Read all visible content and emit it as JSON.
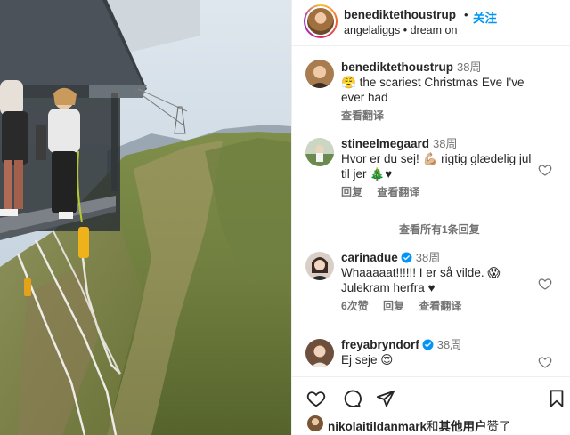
{
  "post": {
    "username": "benediktethoustrup",
    "follow_label": "关注",
    "separator": "•",
    "collaborator": "angelaliggs",
    "audio": "dream on"
  },
  "comments": [
    {
      "username": "benediktethoustrup",
      "time": "38周",
      "emoji": "😤",
      "text": "the scariest Christmas Eve I've ever had",
      "translate_label": "查看翻译"
    },
    {
      "username": "stineelmegaard",
      "time": "38周",
      "text": "Hvor er du sej! 💪🏼 rigtig glædelig jul til jer 🎄♥",
      "reply_label": "回复",
      "translate_label": "查看翻译",
      "view_replies_label": "查看所有1条回复"
    },
    {
      "username": "carinadue",
      "verified": true,
      "time": "38周",
      "text": "Whaaaaat!!!!!! I er så vilde. 😱 Julekram herfra ♥",
      "likes_label": "6次赞",
      "reply_label": "回复",
      "translate_label": "查看翻译"
    },
    {
      "username": "freyabryndorf",
      "verified": true,
      "time": "38周",
      "text": "Ej seje 😍"
    }
  ],
  "likes": {
    "user": "nikolaitildanmark",
    "joiner": "和",
    "others": "其他用户",
    "suffix": "赞了"
  },
  "icons": {
    "like": "heart-icon",
    "comment": "comment-icon",
    "share": "share-icon",
    "save": "bookmark-icon",
    "verified": "verified-badge-icon"
  },
  "colors": {
    "accent": "#0095f6",
    "verified": "#0095f6",
    "muted": "#737373",
    "text": "#262626"
  }
}
